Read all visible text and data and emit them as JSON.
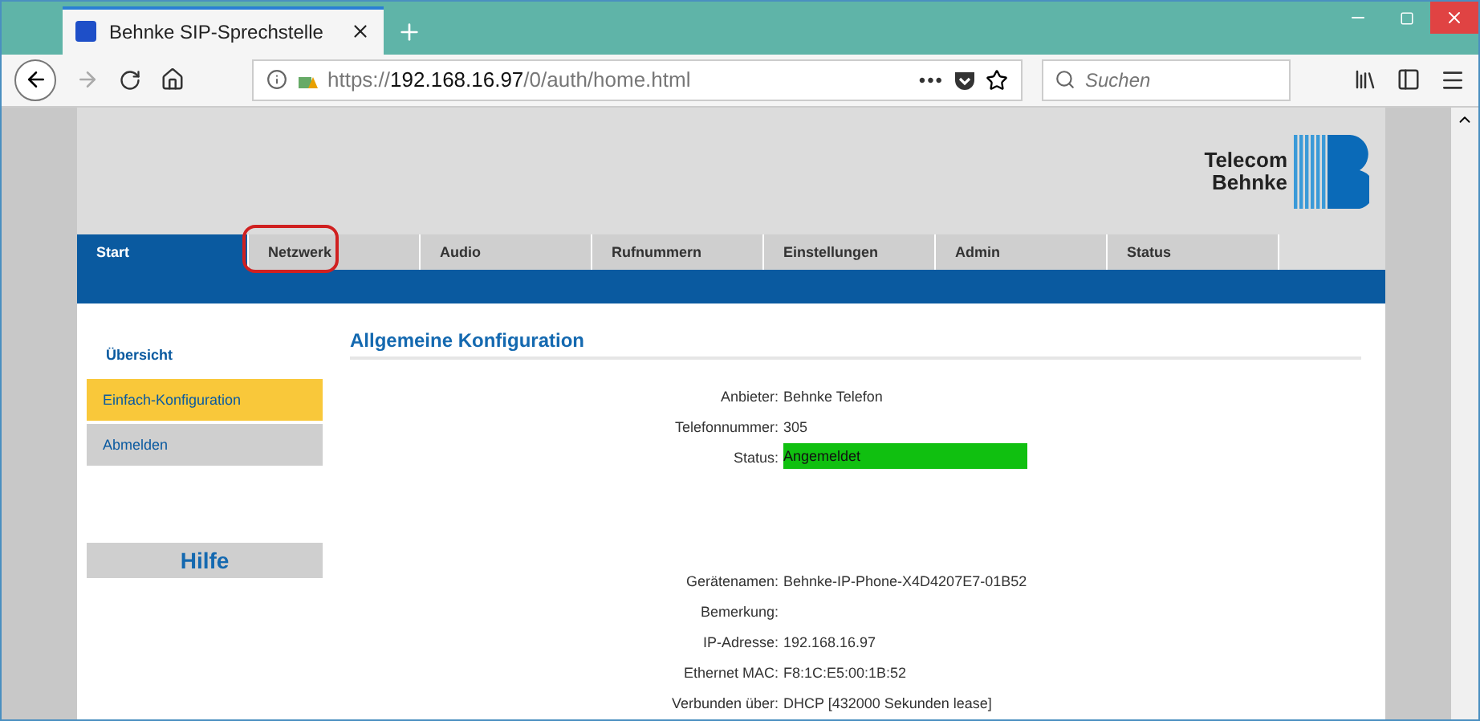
{
  "browser": {
    "tab_title": "Behnke SIP-Sprechstelle",
    "url_prefix": "https://",
    "url_host": "192.168.16.97",
    "url_path": "/0/auth/home.html",
    "more": "•••",
    "search": {
      "placeholder": "Suchen"
    }
  },
  "logo": {
    "line1": "Telecom",
    "line2": "Behnke"
  },
  "nav": [
    {
      "label": "Start",
      "selected": true,
      "highlighted": false
    },
    {
      "label": "Netzwerk",
      "selected": false,
      "highlighted": true
    },
    {
      "label": "Audio",
      "selected": false,
      "highlighted": false
    },
    {
      "label": "Rufnummern",
      "selected": false,
      "highlighted": false
    },
    {
      "label": "Einstellungen",
      "selected": false,
      "highlighted": false
    },
    {
      "label": "Admin",
      "selected": false,
      "highlighted": false
    },
    {
      "label": "Status",
      "selected": false,
      "highlighted": false
    }
  ],
  "sidebar": {
    "heading": "Übersicht",
    "items": [
      {
        "label": "Einfach-Konfiguration",
        "selected": true
      },
      {
        "label": "Abmelden",
        "selected": false
      }
    ],
    "help": "Hilfe"
  },
  "section_title": "Allgemeine Konfiguration",
  "groups": [
    [
      {
        "label": "Anbieter:",
        "value": "Behnke Telefon",
        "kind": "text"
      },
      {
        "label": "Telefonnummer:",
        "value": "305",
        "kind": "text"
      },
      {
        "label": "Status:",
        "value": "Angemeldet",
        "kind": "status"
      }
    ],
    [
      {
        "label": "Gerätenamen:",
        "value": "Behnke-IP-Phone-X4D4207E7-01B52",
        "kind": "text"
      },
      {
        "label": "Bemerkung:",
        "kind": "text"
      },
      {
        "label": "IP-Adresse:",
        "value": "192.168.16.97",
        "kind": "text"
      },
      {
        "label": "Ethernet MAC:",
        "value": "F8:1C:E5:00:1B:52",
        "kind": "text"
      },
      {
        "label": "Verbunden über:",
        "value": "DHCP  [432000 Sekunden lease]",
        "kind": "text"
      }
    ]
  ]
}
